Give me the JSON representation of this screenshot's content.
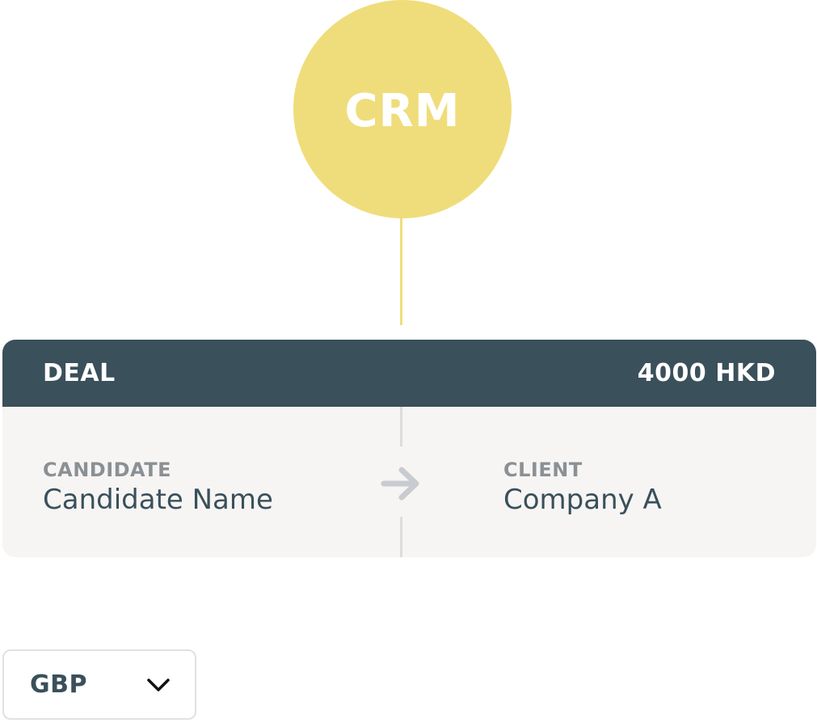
{
  "crm": {
    "label": "CRM",
    "color": "#efdd7b"
  },
  "deal": {
    "title": "DEAL",
    "amount": "4000 HKD",
    "header_color": "#3a505a",
    "candidate": {
      "label": "CANDIDATE",
      "value": "Candidate Name"
    },
    "client": {
      "label": "CLIENT",
      "value": "Company A"
    },
    "arrow_icon": "arrow-right-icon"
  },
  "currency": {
    "selected": "GBP",
    "icon": "chevron-down-icon"
  }
}
